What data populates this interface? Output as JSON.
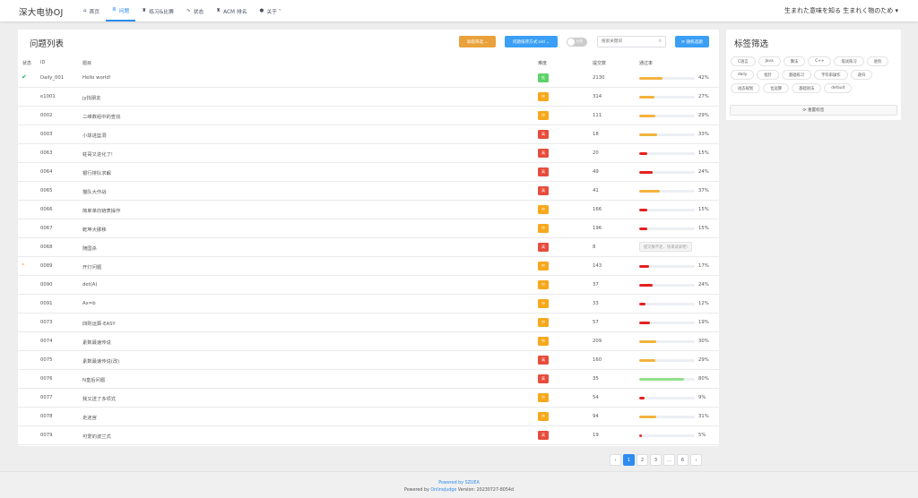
{
  "header": {
    "logo": "深大电协OJ",
    "nav": [
      {
        "icon": "⌂",
        "label": "首页"
      },
      {
        "icon": "≣",
        "label": "问题"
      },
      {
        "icon": "♜",
        "label": "练习&比赛"
      },
      {
        "icon": "∿",
        "label": "状态"
      },
      {
        "icon": "♜",
        "label": "ACM 排名"
      },
      {
        "icon": "●",
        "label": "关于 ˅"
      }
    ],
    "user": "生まれた意味を知る 生まれく物のため ▾"
  },
  "problem_panel": {
    "title": "问题列表",
    "btn_advanced": "高级筛选 ⌄",
    "btn_sort": "问题排序方式:old ⌄",
    "toggle_label": "标签",
    "search_placeholder": "搜索关键词",
    "btn_pick": "⟳ 随机选题",
    "columns": {
      "status": "状态",
      "id": "ID",
      "title": "题目",
      "difficulty": "难度",
      "submissions": "提交数",
      "ac_rate": "通过率"
    },
    "rows": [
      {
        "status": "ok",
        "id": "Daily_001",
        "title": "Hello world!",
        "diff": "低",
        "level": "low",
        "subs": "2130",
        "rate": 42,
        "pct": "42%"
      },
      {
        "status": "",
        "id": "e1001",
        "title": "jy找朋友",
        "diff": "中",
        "level": "mid",
        "subs": "314",
        "rate": 27,
        "pct": "27%"
      },
      {
        "status": "",
        "id": "0002",
        "title": "二维数组中的查找",
        "diff": "中",
        "level": "mid",
        "subs": "111",
        "rate": 29,
        "pct": "29%"
      },
      {
        "status": "",
        "id": "0003",
        "title": "小球进篮洞",
        "diff": "高",
        "level": "high",
        "subs": "18",
        "rate": 33,
        "pct": "33%"
      },
      {
        "status": "",
        "id": "0063",
        "title": "蛀哥又进化了!",
        "diff": "高",
        "level": "high",
        "subs": "20",
        "rate": 15,
        "pct": "15%"
      },
      {
        "status": "",
        "id": "0064",
        "title": "银行排队求解",
        "diff": "高",
        "level": "high",
        "subs": "49",
        "rate": 24,
        "pct": "24%"
      },
      {
        "status": "",
        "id": "0065",
        "title": "猫队大作战",
        "diff": "高",
        "level": "high",
        "subs": "41",
        "rate": 37,
        "pct": "37%"
      },
      {
        "status": "",
        "id": "0066",
        "title": "简单单向链表操作",
        "diff": "中",
        "level": "mid",
        "subs": "166",
        "rate": 15,
        "pct": "15%"
      },
      {
        "status": "",
        "id": "0067",
        "title": "乾坤大挪移",
        "diff": "中",
        "level": "mid",
        "subs": "196",
        "rate": 15,
        "pct": "15%"
      },
      {
        "status": "",
        "id": "0068",
        "title": "随国杀",
        "diff": "高",
        "level": "high",
        "subs": "8",
        "rate": null,
        "pct": "",
        "tip": "提交数不足，快来试试吧!"
      },
      {
        "status": "try",
        "id": "0089",
        "title": "开灯问题",
        "diff": "中",
        "level": "mid",
        "subs": "143",
        "rate": 17,
        "pct": "17%"
      },
      {
        "status": "",
        "id": "0090",
        "title": "det(A)",
        "diff": "中",
        "level": "mid",
        "subs": "37",
        "rate": 24,
        "pct": "24%"
      },
      {
        "status": "",
        "id": "0091",
        "title": "Ax=b",
        "diff": "中",
        "level": "mid",
        "subs": "33",
        "rate": 12,
        "pct": "12%"
      },
      {
        "status": "",
        "id": "0073",
        "title": "四则运算-EASY",
        "diff": "中",
        "level": "mid",
        "subs": "57",
        "rate": 19,
        "pct": "19%"
      },
      {
        "status": "",
        "id": "0074",
        "title": "素数最速传说",
        "diff": "中",
        "level": "mid",
        "subs": "209",
        "rate": 30,
        "pct": "30%"
      },
      {
        "status": "",
        "id": "0075",
        "title": "素数最速传说(改)",
        "diff": "高",
        "level": "high",
        "subs": "160",
        "rate": 29,
        "pct": "29%"
      },
      {
        "status": "",
        "id": "0076",
        "title": "N皇后问题",
        "diff": "高",
        "level": "high",
        "subs": "35",
        "rate": 80,
        "pct": "80%"
      },
      {
        "status": "",
        "id": "0077",
        "title": "我又送了多项式",
        "diff": "中",
        "level": "mid",
        "subs": "54",
        "rate": 9,
        "pct": "9%"
      },
      {
        "status": "",
        "id": "0078",
        "title": "走迷宫",
        "diff": "中",
        "level": "mid",
        "subs": "94",
        "rate": 31,
        "pct": "31%"
      },
      {
        "status": "",
        "id": "0079",
        "title": "可爱的波兰式",
        "diff": "高",
        "level": "high",
        "subs": "19",
        "rate": 5,
        "pct": "5%"
      }
    ]
  },
  "pagination": {
    "prev": "‹",
    "pages": [
      "1",
      "2",
      "3",
      "…",
      "6"
    ],
    "next": "›",
    "active": "1"
  },
  "tag_panel": {
    "title": "标签筛选",
    "tags": [
      "C语言",
      "Java",
      "算法",
      "C++",
      "笔试练习",
      "进阶",
      "daily",
      "指针",
      "基础练习",
      "字符串操作",
      "递归",
      "动态规划",
      "位运算",
      "基础语法",
      "default"
    ],
    "reset": "⟳ 重置标签"
  },
  "footer": {
    "line1": "Powered by SZUEA",
    "line2_prefix": "Powered by ",
    "line2_link": "OnlineJudge",
    "line2_suffix": "  Version: 20230727-8054d"
  },
  "colors": {
    "accent": "#2d8cf0",
    "low": "#5cd268",
    "mid": "#f7a81b",
    "high": "#e74c3c",
    "bar_green": "#91e08a",
    "bar_orange": "#f2b33d",
    "bar_red": "#e5201f"
  }
}
